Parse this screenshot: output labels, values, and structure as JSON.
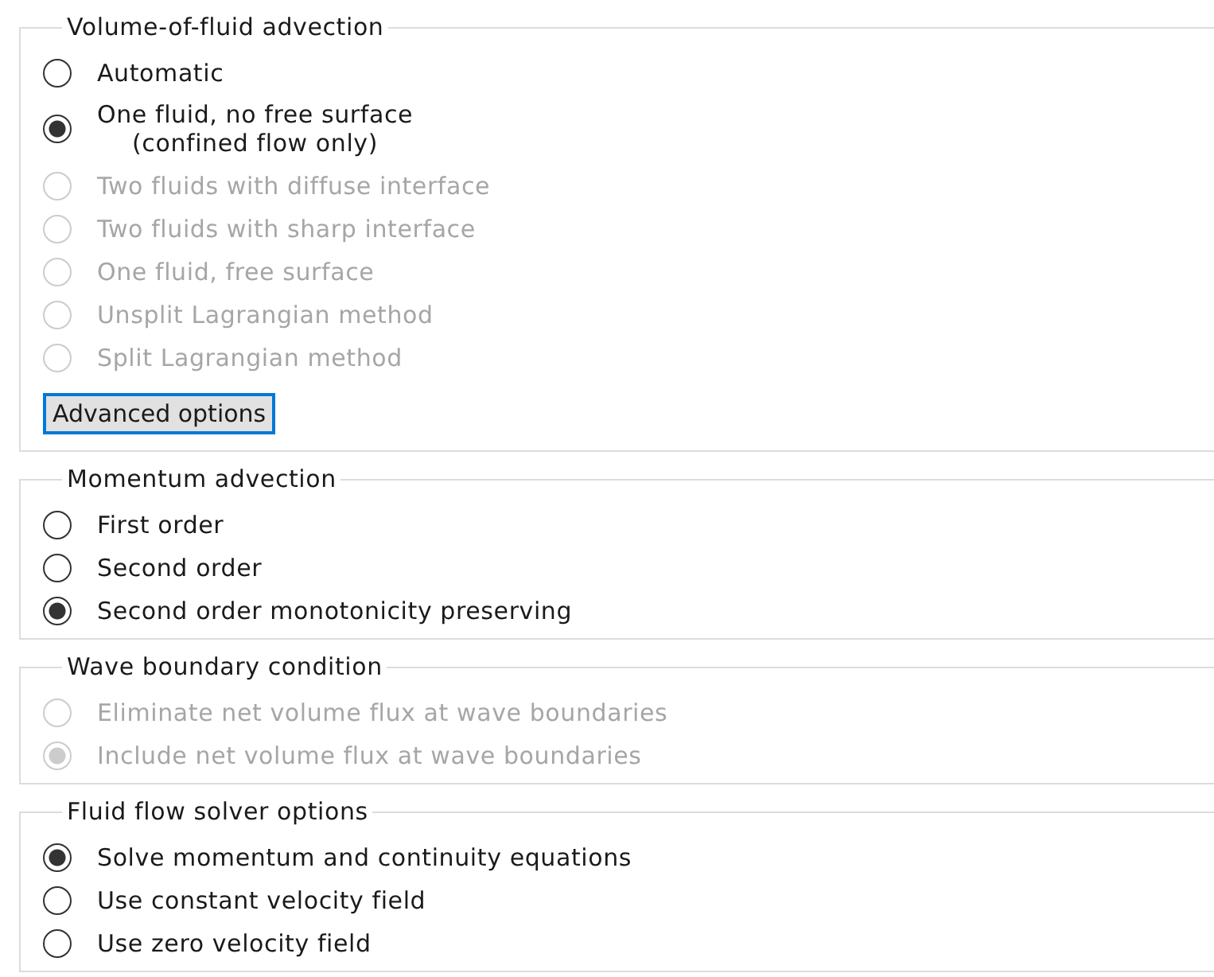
{
  "groups": [
    {
      "title": "Volume-of-fluid advection",
      "options": [
        {
          "label": "Automatic",
          "selected": false,
          "disabled": false
        },
        {
          "label": "One fluid, no free surface\n(confined flow only)",
          "selected": true,
          "disabled": false
        },
        {
          "label": "Two fluids with diffuse interface",
          "selected": false,
          "disabled": true
        },
        {
          "label": "Two fluids with sharp interface",
          "selected": false,
          "disabled": true
        },
        {
          "label": "One fluid, free surface",
          "selected": false,
          "disabled": true
        },
        {
          "label": "Unsplit Lagrangian method",
          "selected": false,
          "disabled": true
        },
        {
          "label": "Split Lagrangian method",
          "selected": false,
          "disabled": true
        }
      ],
      "button": {
        "label": "Advanced options",
        "focused": true
      }
    },
    {
      "title": "Momentum advection",
      "options": [
        {
          "label": "First order",
          "selected": false,
          "disabled": false
        },
        {
          "label": "Second order",
          "selected": false,
          "disabled": false
        },
        {
          "label": "Second order monotonicity preserving",
          "selected": true,
          "disabled": false
        }
      ]
    },
    {
      "title": "Wave boundary condition",
      "options": [
        {
          "label": "Eliminate net volume flux at wave boundaries",
          "selected": false,
          "disabled": true
        },
        {
          "label": "Include net volume flux at wave boundaries",
          "selected": true,
          "disabled": true
        }
      ]
    },
    {
      "title": "Fluid flow solver options",
      "options": [
        {
          "label": "Solve momentum and continuity equations",
          "selected": true,
          "disabled": false
        },
        {
          "label": "Use constant velocity field",
          "selected": false,
          "disabled": false
        },
        {
          "label": "Use zero velocity field",
          "selected": false,
          "disabled": false
        }
      ]
    }
  ]
}
